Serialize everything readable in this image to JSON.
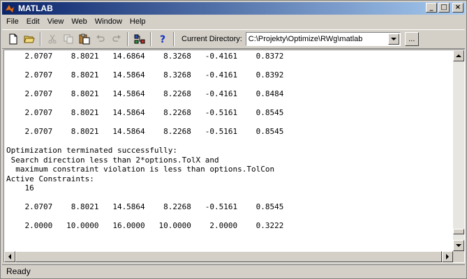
{
  "window": {
    "title": "MATLAB",
    "controls": {
      "minimize": "_",
      "maximize": "□",
      "close": "×"
    }
  },
  "menu": [
    "File",
    "Edit",
    "View",
    "Web",
    "Window",
    "Help"
  ],
  "toolbar": {
    "current_directory_label": "Current Directory:",
    "current_directory_value": "C:\\Projekty\\Optimize\\RWg\\matlab",
    "browse_label": "...",
    "icons": [
      "new-file-icon",
      "open-folder-icon",
      "cut-icon",
      "copy-icon",
      "paste-icon",
      "undo-icon",
      "redo-icon",
      "simulink-icon",
      "help-icon"
    ]
  },
  "command_window": {
    "lines": [
      "    2.0707    8.8021   14.6864    8.3268   -0.4161    0.8372",
      "",
      "    2.0707    8.8021   14.5864    8.3268   -0.4161    0.8392",
      "",
      "    2.0707    8.8021   14.5864    8.2268   -0.4161    0.8484",
      "",
      "    2.0707    8.8021   14.5864    8.2268   -0.5161    0.8545",
      "",
      "    2.0707    8.8021   14.5864    8.2268   -0.5161    0.8545",
      "",
      "Optimization terminated successfully:",
      " Search direction less than 2*options.TolX and",
      "  maximum constraint violation is less than options.TolCon",
      "Active Constraints:",
      "    16",
      "",
      "    2.0707    8.8021   14.5864    8.2268   -0.5161    0.8545",
      "",
      "    2.0000   10.0000   16.0000   10.0000    2.0000    0.3222",
      ""
    ]
  },
  "status": {
    "text": "Ready"
  }
}
